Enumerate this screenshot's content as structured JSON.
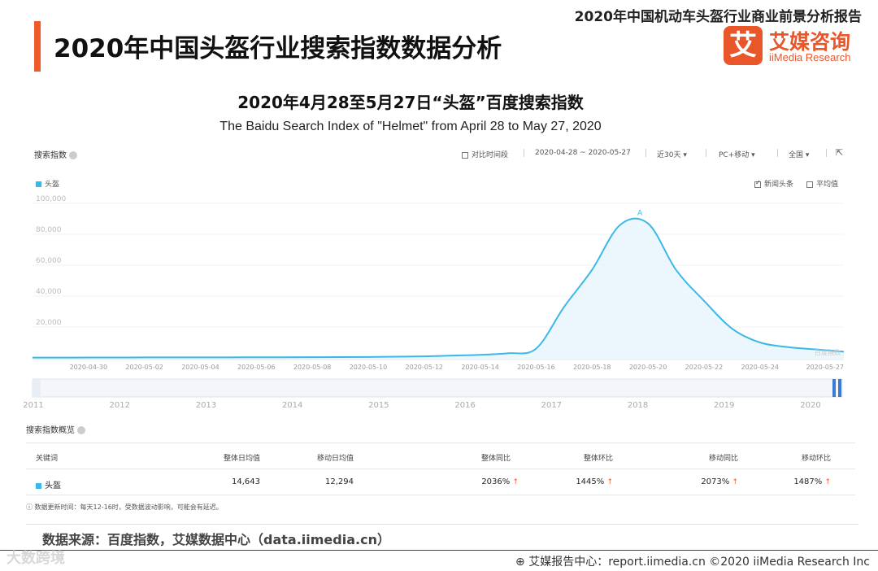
{
  "report_tag": "2020年中国机动车头盔行业商业前景分析报告",
  "page_title": "2020年中国头盔行业搜索指数数据分析",
  "brand": {
    "logo_char": "艾",
    "name_cn": "艾媒咨询",
    "name_en": "iiMedia Research"
  },
  "chart_title": "2020年4月28至5月27日“头盔”百度搜索指数",
  "chart_subtitle": "The Baidu Search Index of \"Helmet\" from April 28 to May 27, 2020",
  "toolbar": {
    "panel_title": "搜索指数",
    "compare_label": "对比时间段",
    "date_range": "2020-04-28 ~ 2020-05-27",
    "period": "近30天",
    "device": "PC+移动",
    "region": "全国",
    "dropdown_arrow": "▾",
    "external_icon": "⇱"
  },
  "chart_options": {
    "news_label": "新闻头条",
    "avg_label": "平均值",
    "peak_marker": "A"
  },
  "chart_data": {
    "type": "area",
    "series_name": "头盔",
    "series_color": "#3bb8e8",
    "y_ticks": [
      "20,000",
      "40,000",
      "60,000",
      "80,000",
      "100,000"
    ],
    "ylim": [
      0,
      100000
    ],
    "x": [
      "2020-04-28",
      "2020-04-29",
      "2020-04-30",
      "2020-05-01",
      "2020-05-02",
      "2020-05-03",
      "2020-05-04",
      "2020-05-05",
      "2020-05-06",
      "2020-05-07",
      "2020-05-08",
      "2020-05-09",
      "2020-05-10",
      "2020-05-11",
      "2020-05-12",
      "2020-05-13",
      "2020-05-14",
      "2020-05-15",
      "2020-05-16",
      "2020-05-17",
      "2020-05-18",
      "2020-05-19",
      "2020-05-20",
      "2020-05-21",
      "2020-05-22",
      "2020-05-23",
      "2020-05-24",
      "2020-05-25",
      "2020-05-26",
      "2020-05-27"
    ],
    "x_tick_labels": [
      "2020-04-30",
      "2020-05-02",
      "2020-05-04",
      "2020-05-06",
      "2020-05-08",
      "2020-05-10",
      "2020-05-12",
      "2020-05-14",
      "2020-05-16",
      "2020-05-18",
      "2020-05-20",
      "2020-05-22",
      "2020-05-24",
      "2020-05-27"
    ],
    "values": [
      200,
      200,
      250,
      250,
      300,
      300,
      350,
      350,
      400,
      400,
      450,
      500,
      600,
      800,
      1000,
      1500,
      2000,
      3000,
      6000,
      33000,
      57000,
      86000,
      87000,
      57000,
      37000,
      19000,
      10000,
      7000,
      5500,
      4000
    ],
    "timeline_years": [
      "2011",
      "2012",
      "2013",
      "2014",
      "2015",
      "2016",
      "2017",
      "2018",
      "2019",
      "2020"
    ],
    "watermark": "百度指数"
  },
  "table": {
    "title": "搜索指数概览",
    "headers": [
      "关键词",
      "整体日均值",
      "移动日均值",
      "整体同比",
      "整体环比",
      "移动同比",
      "移动环比"
    ],
    "rows": [
      {
        "keyword": "头盔",
        "overall_avg": "14,643",
        "mobile_avg": "12,294",
        "overall_yoy": "2036%",
        "overall_mom": "1445%",
        "mobile_yoy": "2073%",
        "mobile_mom": "1487%"
      }
    ],
    "up_arrow": "↑",
    "note": "数据更新时间：每天12-16时，受数据波动影响，可能会有延迟。"
  },
  "source": "数据来源：百度指数，艾媒数据中心（data.iimedia.cn）",
  "footer": "艾媒报告中心：report.iimedia.cn ©2020 iiMedia Research Inc",
  "watermark": "大数跨境"
}
